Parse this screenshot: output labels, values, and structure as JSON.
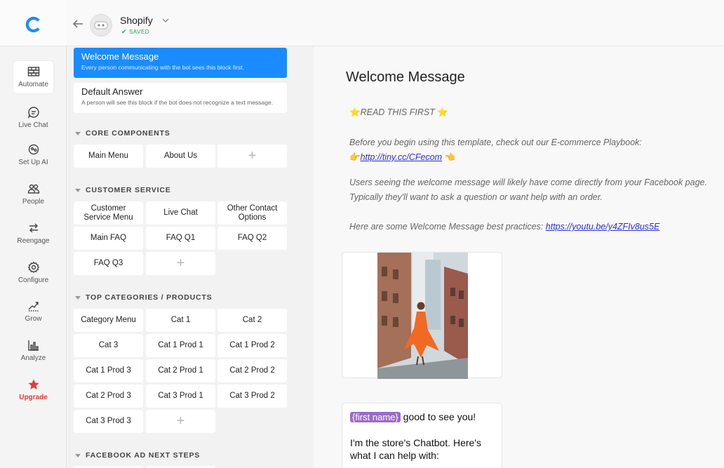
{
  "nav": {
    "items": [
      {
        "label": "Automate",
        "icon": "bricks-icon"
      },
      {
        "label": "Live Chat",
        "icon": "chat-bubble-icon"
      },
      {
        "label": "Set Up AI",
        "icon": "ai-brain-icon"
      },
      {
        "label": "People",
        "icon": "people-icon"
      },
      {
        "label": "Reengage",
        "icon": "swap-arrows-icon"
      },
      {
        "label": "Configure",
        "icon": "gear-icon"
      },
      {
        "label": "Grow",
        "icon": "trend-up-icon"
      },
      {
        "label": "Analyze",
        "icon": "bar-chart-icon"
      },
      {
        "label": "Upgrade",
        "icon": "star-icon"
      }
    ],
    "brand_color": "#1a8cff",
    "upgrade_color": "#e23b3b"
  },
  "header": {
    "bot_name": "Shopify",
    "status": "SAVED"
  },
  "blocks": {
    "pinned": [
      {
        "title": "Welcome Message",
        "description": "Every person communicating with the bot sees this block first."
      },
      {
        "title": "Default Answer",
        "description": "A person will see this block if the bot does not recognize a text message."
      }
    ],
    "sections": [
      {
        "name": "CORE COMPONENTS",
        "items": [
          "Main Menu",
          "About Us"
        ]
      },
      {
        "name": "CUSTOMER SERVICE",
        "items": [
          "Customer Service Menu",
          "Live Chat",
          "Other Contact Options",
          "Main FAQ",
          "FAQ Q1",
          "FAQ Q2",
          "FAQ Q3"
        ]
      },
      {
        "name": "TOP CATEGORIES / PRODUCTS",
        "items": [
          "Category Menu",
          "Cat 1",
          "Cat 2",
          "Cat 3",
          "Cat 1 Prod 1",
          "Cat 1 Prod 2",
          "Cat 1 Prod 3",
          "Cat 2 Prod 1",
          "Cat 2 Prod 2",
          "Cat 2 Prod 3",
          "Cat 3 Prod 1",
          "Cat 3 Prod 2",
          "Cat 3 Prod 3"
        ]
      },
      {
        "name": "FACEBOOK AD NEXT STEPS",
        "items": []
      }
    ],
    "add_label": "+"
  },
  "editor": {
    "title": "Welcome Message",
    "lines": {
      "read_first": "READ THIS FIRST",
      "before_begin": "Before you begin using this template, check out our E-commerce Playbook:",
      "playbook_link": "http://tiny.cc/CFecom",
      "users_seeing": "Users seeing the welcome message will likely have come directly from your Facebook page.",
      "typically": "Typically they'll want to ask a question or want help with an order.",
      "best_practices": "Here are some Welcome Message best practices:",
      "best_practices_link": "https://youtu.be/y4ZFIv8us5E"
    },
    "text_card": {
      "variable": "{first name}",
      "line1_rest": " good to see you!",
      "line2": "I'm the store's Chatbot.  Here's what I can help with:"
    }
  }
}
